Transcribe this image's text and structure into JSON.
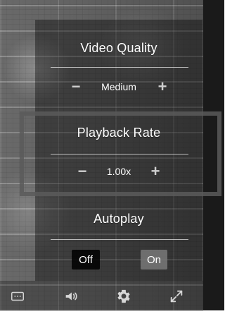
{
  "settings_panel": {
    "video_quality": {
      "title": "Video Quality",
      "decrease_label": "−",
      "value": "Medium",
      "increase_label": "+"
    },
    "playback_rate": {
      "title": "Playback Rate",
      "decrease_label": "−",
      "value": "1.00x",
      "increase_label": "+"
    },
    "autoplay": {
      "title": "Autoplay",
      "off_label": "Off",
      "on_label": "On"
    }
  },
  "control_bar": {
    "icons": [
      {
        "name": "captions-icon"
      },
      {
        "name": "volume-icon"
      },
      {
        "name": "gear-icon"
      },
      {
        "name": "fullscreen-icon"
      }
    ]
  },
  "colors": {
    "text": "#ffffff",
    "panel_overlay": "rgba(0,0,0,0.38)",
    "toggle_off_bg": "#111111",
    "toggle_on_bg": "#7a7a7a",
    "highlight_outline": "#5a5a5a"
  }
}
